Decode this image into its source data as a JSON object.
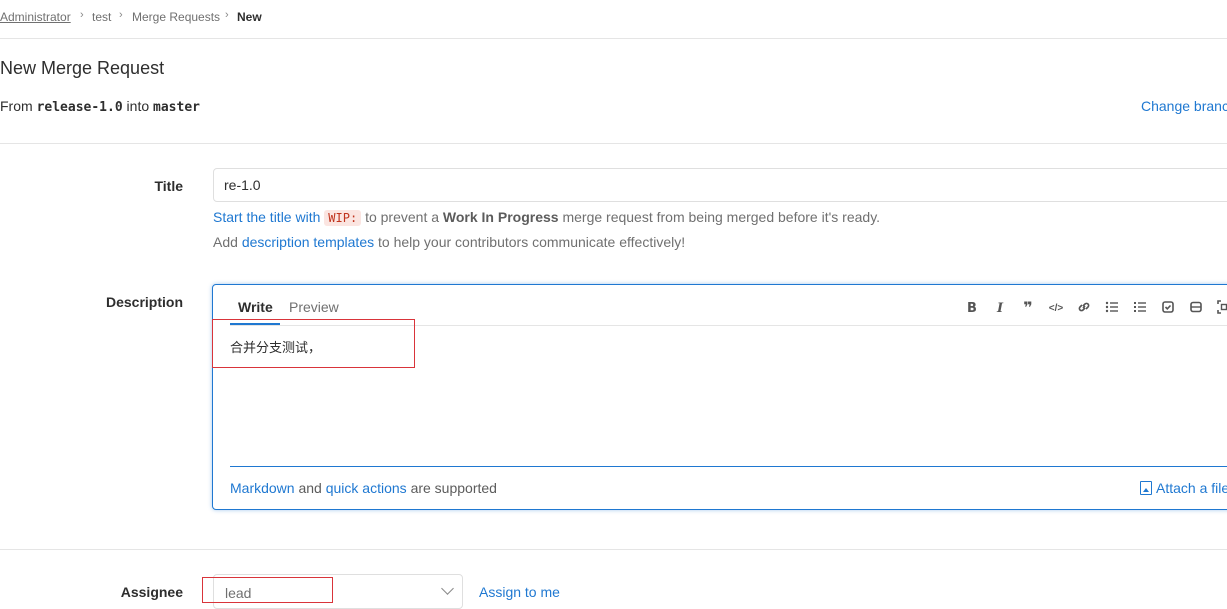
{
  "breadcrumb": {
    "items": [
      "Administrator",
      "test",
      "Merge Requests",
      "New"
    ]
  },
  "page": {
    "title": "New Merge Request",
    "from_prefix": "From",
    "source_branch": "release-1.0",
    "into_word": "into",
    "target_branch": "master",
    "change_branches": "Change branches"
  },
  "title_field": {
    "label": "Title",
    "value": "re-1.0",
    "hint_link": "Start the title with",
    "hint_code": "WIP:",
    "hint_mid": "to prevent a",
    "hint_bold": "Work In Progress",
    "hint_end": "merge request from being merged before it's ready.",
    "templates_prefix": "Add",
    "templates_link": "description templates",
    "templates_suffix": "to help your contributors communicate effectively!"
  },
  "description": {
    "label": "Description",
    "tab_write": "Write",
    "tab_preview": "Preview",
    "content": "合并分支测试，",
    "footer_markdown": "Markdown",
    "footer_and": "and",
    "footer_quick_actions": "quick actions",
    "footer_supported": "are supported",
    "attach": "Attach a file",
    "toolbar": [
      "bold-icon",
      "italic-icon",
      "quote-icon",
      "code-icon",
      "link-icon",
      "bullet-list-icon",
      "numbered-list-icon",
      "task-list-icon",
      "table-icon",
      "fullscreen-icon"
    ]
  },
  "assignee": {
    "label": "Assignee",
    "value": "lead",
    "assign_to_me": "Assign to me"
  },
  "colors": {
    "link": "#1f78d1",
    "annotation": "#d9343a",
    "wip_code": "#c0341d"
  }
}
